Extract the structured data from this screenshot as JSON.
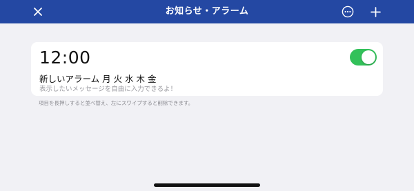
{
  "header": {
    "title": "お知らせ・アラーム",
    "close_icon": "close-icon",
    "more_icon": "more-icon",
    "add_icon": "plus-icon"
  },
  "alarm": {
    "time": "12:00",
    "name": "新しいアラーム",
    "days": "月 火 水 木 金",
    "message": "表示したいメッセージを自由に入力できるよ！",
    "enabled": true
  },
  "hint": "項目を長押しすると並べ替え、左にスワイプすると削除できます。",
  "colors": {
    "header_bg": "#2448a3",
    "page_bg": "#f1f1f5",
    "toggle_on": "#33c15a"
  }
}
